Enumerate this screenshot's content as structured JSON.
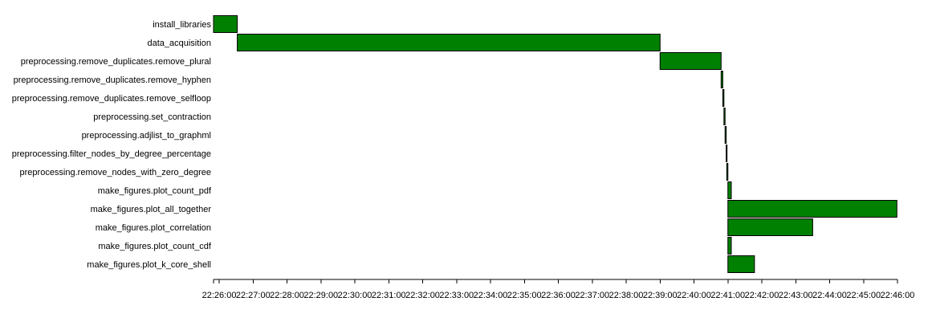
{
  "chart_data": {
    "type": "gantt",
    "title": "",
    "xlabel": "",
    "ylabel": "",
    "grid": false,
    "x_axis": {
      "unit": "time (HH:MM:SS)",
      "range": [
        "22:25:50",
        "22:46:00"
      ],
      "tick_labels": [
        "22:26:00",
        "22:27:00",
        "22:28:00",
        "22:29:00",
        "22:30:00",
        "22:31:00",
        "22:32:00",
        "22:33:00",
        "22:34:00",
        "22:35:00",
        "22:36:00",
        "22:37:00",
        "22:38:00",
        "22:39:00",
        "22:40:00",
        "22:41:00",
        "22:42:00",
        "22:43:00",
        "22:44:00",
        "22:45:00",
        "22:46:00"
      ]
    },
    "bar_color": "#008000",
    "bar_stroke": "#000000",
    "tasks": [
      {
        "name": "install_libraries",
        "start": "22:25:50",
        "end": "22:26:32"
      },
      {
        "name": "data_acquisition",
        "start": "22:26:32",
        "end": "22:39:00"
      },
      {
        "name": "preprocessing.remove_duplicates.remove_plural",
        "start": "22:39:00",
        "end": "22:40:48"
      },
      {
        "name": "preprocessing.remove_duplicates.remove_hyphen",
        "start": "22:40:48",
        "end": "22:40:51"
      },
      {
        "name": "preprocessing.remove_duplicates.remove_selfloop",
        "start": "22:40:51",
        "end": "22:40:53"
      },
      {
        "name": "preprocessing.set_contraction",
        "start": "22:40:53",
        "end": "22:40:55"
      },
      {
        "name": "preprocessing.adjlist_to_graphml",
        "start": "22:40:55",
        "end": "22:40:57"
      },
      {
        "name": "preprocessing.filter_nodes_by_degree_percentage",
        "start": "22:40:57",
        "end": "22:40:58"
      },
      {
        "name": "preprocessing.remove_nodes_with_zero_degree",
        "start": "22:40:58",
        "end": "22:41:00"
      },
      {
        "name": "make_figures.plot_count_pdf",
        "start": "22:41:00",
        "end": "22:41:06"
      },
      {
        "name": "make_figures.plot_all_together",
        "start": "22:41:00",
        "end": "22:45:59"
      },
      {
        "name": "make_figures.plot_correlation",
        "start": "22:41:00",
        "end": "22:43:30"
      },
      {
        "name": "make_figures.plot_count_cdf",
        "start": "22:41:00",
        "end": "22:41:06"
      },
      {
        "name": "make_figures.plot_k_core_shell",
        "start": "22:41:00",
        "end": "22:41:47"
      }
    ]
  }
}
